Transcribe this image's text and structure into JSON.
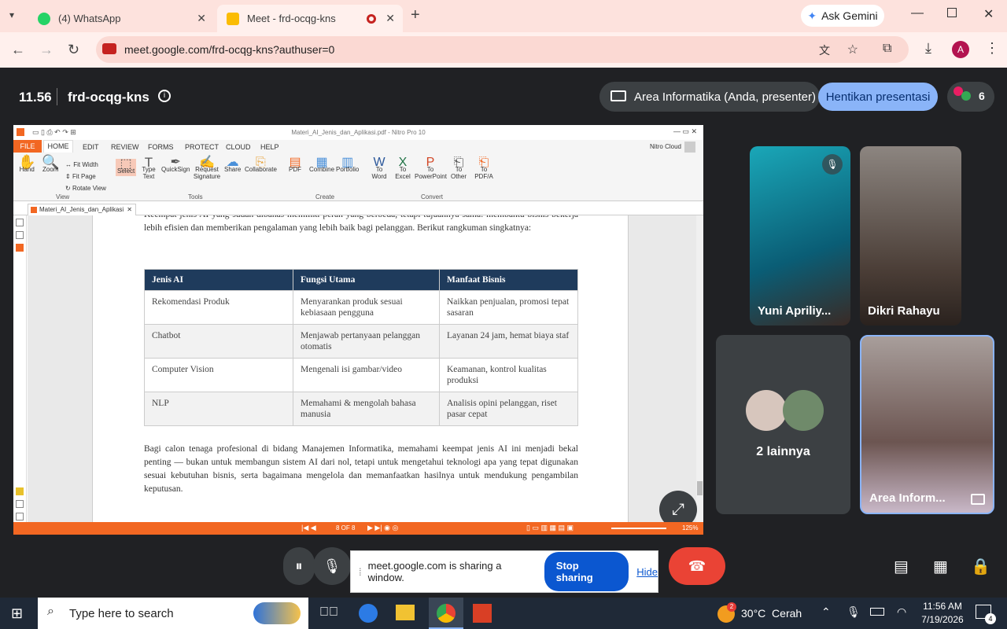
{
  "browser": {
    "tabs": [
      {
        "label": "(4) WhatsApp"
      },
      {
        "label": "Meet - frd-ocqg-kns"
      }
    ],
    "ask_gemini": "Ask Gemini",
    "url": "meet.google.com/frd-ocqg-kns?authuser=0",
    "profile_initial": "A"
  },
  "meet": {
    "time": "11.56",
    "meeting_code": "frd-ocqg-kns",
    "presenter_label": "Area Informatika (Anda, presenter)",
    "stop_presenting": "Hentikan presentasi",
    "participant_count": "6",
    "participants": [
      {
        "name": "Yuni Apriliy..."
      },
      {
        "name": "Dikri Rahayu"
      },
      {
        "name": "2 lainnya"
      },
      {
        "name": "Area Inform..."
      }
    ],
    "share_notice": "meet.google.com is sharing a window.",
    "stop_sharing": "Stop sharing",
    "hide": "Hide"
  },
  "nitro": {
    "window_title": "Materi_AI_Jenis_dan_Aplikasi.pdf - Nitro Pro 10",
    "ribbon_tabs": [
      "FILE",
      "HOME",
      "EDIT",
      "REVIEW",
      "FORMS",
      "PROTECT",
      "CLOUD",
      "HELP"
    ],
    "account": "Nitro Cloud",
    "view_group": {
      "hand": "Hand",
      "zoom": "Zoom",
      "fit_width": "Fit Width",
      "fit_page": "Fit Page",
      "rotate_view": "Rotate View",
      "label": "View"
    },
    "tools_group": {
      "select": "Select",
      "type_text": "Type Text",
      "quicksign": "QuickSign",
      "request_signature": "Request Signature",
      "share": "Share",
      "collaborate": "Collaborate",
      "label": "Tools"
    },
    "create_group": {
      "pdf": "PDF",
      "combine": "Combine",
      "portfolio": "Portfolio",
      "label": "Create"
    },
    "convert_group": {
      "to_word": "To Word",
      "to_excel": "To Excel",
      "to_powerpoint": "To PowerPoint",
      "to_other": "To Other",
      "to_pdfa": "To PDF/A",
      "label": "Convert"
    },
    "doc_tab": "Materi_AI_Jenis_dan_Aplikasi",
    "page_indicator": "8 OF 8",
    "zoom_level": "125%"
  },
  "document": {
    "intro_text": "Keempat jenis AI yang sudah dibahas memiliki peran yang berbeda, tetapi tujuannya sama: membantu bisnis bekerja lebih efisien dan memberikan pengalaman yang lebih baik bagi pelanggan. Berikut rangkuman singkatnya:",
    "table_headers": [
      "Jenis AI",
      "Fungsi Utama",
      "Manfaat Bisnis"
    ],
    "table_rows": [
      [
        "Rekomendasi Produk",
        "Menyarankan produk sesuai kebiasaan pengguna",
        "Naikkan penjualan, promosi tepat sasaran"
      ],
      [
        "Chatbot",
        "Menjawab pertanyaan pelanggan otomatis",
        "Layanan 24 jam, hemat biaya staf"
      ],
      [
        "Computer Vision",
        "Mengenali isi gambar/video",
        "Keamanan, kontrol kualitas produksi"
      ],
      [
        "NLP",
        "Memahami & mengolah bahasa manusia",
        "Analisis opini pelanggan, riset pasar cepat"
      ]
    ],
    "closing_text": "Bagi calon tenaga profesional di bidang Manajemen Informatika, memahami keempat jenis AI ini menjadi bekal penting — bukan untuk membangun sistem AI dari nol, tetapi untuk mengetahui teknologi apa yang tepat digunakan sesuai kebutuhan bisnis, serta bagaimana mengelola dan memanfaatkan hasilnya untuk mendukung pengambilan keputusan."
  },
  "taskbar": {
    "search_placeholder": "Type here to search",
    "weather": "30°C  Cerah",
    "weather_badge": "2",
    "clock_time": "11:56 AM",
    "clock_date": "7/19/2026",
    "notification_count": "4"
  },
  "colors": {
    "nitro_orange": "#f26722",
    "meet_blue": "#8ab4f8",
    "end_call_red": "#ea4335",
    "share_blue": "#0b57d0"
  }
}
